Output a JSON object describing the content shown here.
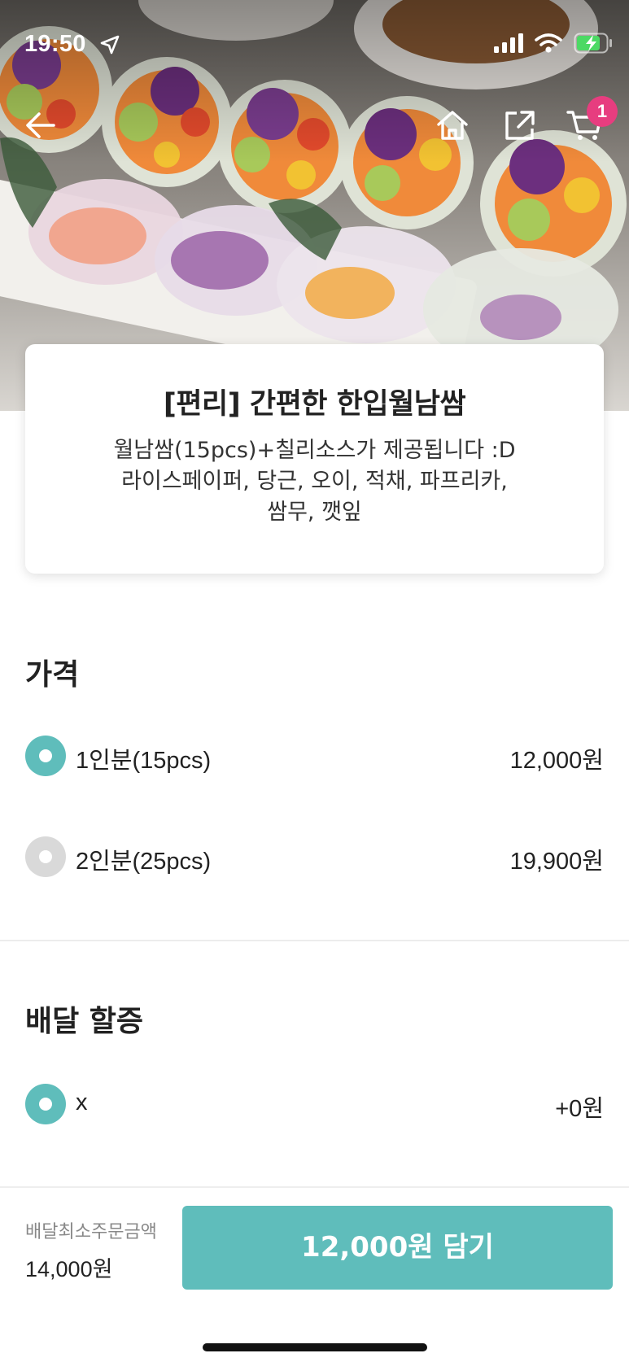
{
  "status_bar": {
    "time": "19:50"
  },
  "nav": {
    "cart_count": "1"
  },
  "product": {
    "title": "[편리] 간편한 한입월남쌈",
    "description_lines": [
      "월남쌈(15pcs)+칠리소스가 제공됩니다 :D",
      "라이스페이퍼, 당근, 오이, 적채, 파프리카,",
      "쌈무, 깻잎"
    ]
  },
  "price_section": {
    "title": "가격",
    "options": [
      {
        "label": "1인분(15pcs)",
        "price": "12,000원",
        "selected": true
      },
      {
        "label": "2인분(25pcs)",
        "price": "19,900원",
        "selected": false
      }
    ]
  },
  "delivery_section": {
    "title": "배달 할증",
    "options": [
      {
        "label": "x",
        "price": "+0원",
        "selected": true
      }
    ]
  },
  "bottom_bar": {
    "min_order_label": "배달최소주문금액",
    "min_order_value": "14,000원",
    "add_button_label": "12,000원 담기"
  },
  "colors": {
    "accent": "#5fbdbb",
    "badge": "#e73d7f",
    "radio_off": "#d9d9d9"
  },
  "icons": [
    "location-arrow-icon",
    "signal-icon",
    "wifi-icon",
    "battery-charging-icon",
    "back-arrow-icon",
    "home-icon",
    "share-icon",
    "cart-icon"
  ]
}
